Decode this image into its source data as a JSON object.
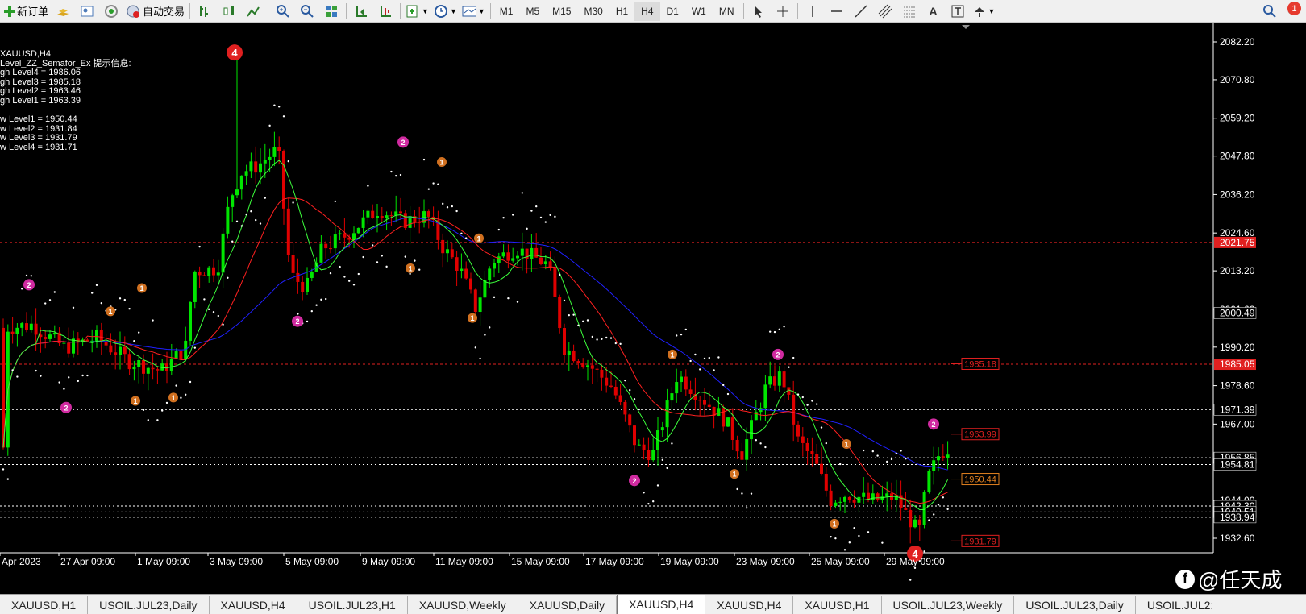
{
  "toolbar": {
    "new_order": "新订单",
    "auto_trading": "自动交易",
    "timeframes": [
      "M1",
      "M5",
      "M15",
      "M30",
      "H1",
      "H4",
      "D1",
      "W1",
      "MN"
    ],
    "active_timeframe": "H4",
    "notification_count": "1"
  },
  "chart": {
    "symbol_label": "XAUUSD,H4",
    "indicator_title": "Level_ZZ_Semafor_Ex 提示信息:",
    "high_levels": [
      "gh Level4 = 1986.06",
      "gh Level3 = 1985.18",
      "gh Level2 = 1963.46",
      "gh Level1 = 1963.39"
    ],
    "low_levels": [
      "w Level1 = 1950.44",
      "w Level2 = 1931.84",
      "w Level3 = 1931.79",
      "w Level4 = 1931.71"
    ],
    "price_ticks": [
      "2082.20",
      "2070.80",
      "2059.20",
      "2047.80",
      "2036.20",
      "2024.60",
      "2013.20",
      "2001.60",
      "1990.20",
      "1978.60",
      "1967.00",
      "1955.40",
      "1944.00",
      "1932.60"
    ],
    "price_tags": [
      {
        "text": "2021.75",
        "color": "#e02020"
      },
      {
        "text": "2000.49",
        "color": "#ffffff"
      },
      {
        "text": "1985.05",
        "color": "#e02020"
      },
      {
        "text": "1971.39",
        "color": "#ffffff"
      },
      {
        "text": "1956.85",
        "color": "#ffffff"
      },
      {
        "text": "1954.81",
        "color": "#ffffff"
      },
      {
        "text": "1942.30",
        "color": "#ffffff"
      },
      {
        "text": "1940.51",
        "color": "#ffffff"
      },
      {
        "text": "1938.94",
        "color": "#ffffff"
      }
    ],
    "level_boxes": [
      {
        "text": "1985.18",
        "color": "#e02020"
      },
      {
        "text": "1963.99",
        "color": "#e02020"
      },
      {
        "text": "1950.44",
        "color": "#e08020"
      },
      {
        "text": "1931.79",
        "color": "#e02020"
      }
    ],
    "time_labels": [
      "Apr 2023",
      "27 Apr 09:00",
      "1 May 09:00",
      "3 May 09:00",
      "5 May 09:00",
      "9 May 09:00",
      "11 May 09:00",
      "15 May 09:00",
      "17 May 09:00",
      "19 May 09:00",
      "23 May 09:00",
      "25 May 09:00",
      "29 May 09:00"
    ],
    "semafor_marks": [
      "4",
      "2",
      "1",
      "2",
      "1",
      "2"
    ],
    "colors": {
      "up": "#00e600",
      "down": "#e00000",
      "ma_fast": "#3cff3c",
      "ma_mid": "#ff2020",
      "ma_slow": "#2020ff",
      "grid": "#ffffff"
    }
  },
  "tabs": [
    "XAUUSD,H1",
    "USOIL.JUL23,Daily",
    "XAUUSD,H4",
    "USOIL.JUL23,H1",
    "XAUUSD,Weekly",
    "XAUUSD,Daily",
    "XAUUSD,H4",
    "XAUUSD,H4",
    "XAUUSD,H1",
    "USOIL.JUL23,Weekly",
    "USOIL.JUL23,Daily",
    "USOIL.JUL2:"
  ],
  "active_tab_index": 6,
  "watermark": "@任天成"
}
